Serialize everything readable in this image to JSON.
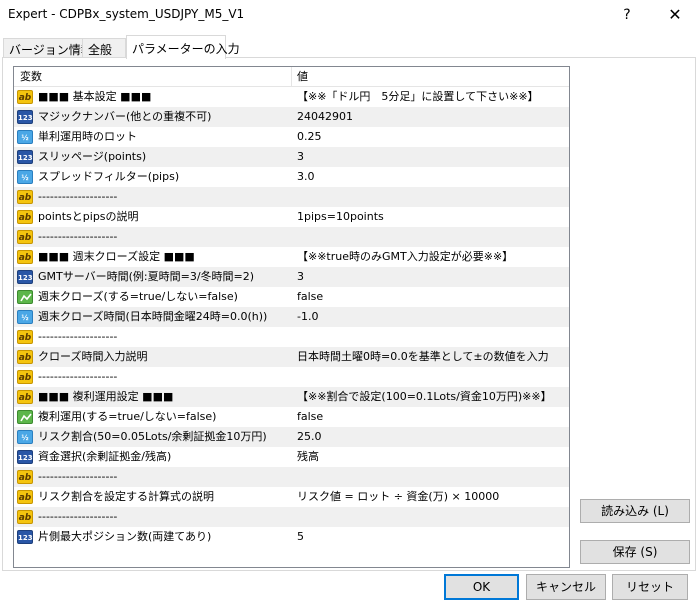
{
  "window": {
    "title": "Expert - CDPBx_system_USDJPY_M5_V1",
    "help_label": "?",
    "close_label": "✕"
  },
  "tabs": [
    {
      "label": "バージョン情報",
      "active": false
    },
    {
      "label": "全般",
      "active": false
    },
    {
      "label": "パラメーターの入力",
      "active": true
    }
  ],
  "grid": {
    "headers": {
      "name": "変数",
      "value": "値"
    },
    "rows": [
      {
        "icon": "ab",
        "name": "■■■ 基本設定 ■■■",
        "value": "【※※「ドル円　5分足」に設置して下さい※※】"
      },
      {
        "icon": "123",
        "name": "マジックナンバー(他との重複不可)",
        "value": "24042901"
      },
      {
        "icon": "frac",
        "name": "単利運用時のロット",
        "value": "0.25"
      },
      {
        "icon": "123",
        "name": "スリッページ(points)",
        "value": "3"
      },
      {
        "icon": "frac",
        "name": "スプレッドフィルター(pips)",
        "value": "3.0"
      },
      {
        "icon": "ab",
        "name": "--------------------",
        "value": ""
      },
      {
        "icon": "ab",
        "name": "pointsとpipsの説明",
        "value": "1pips=10points"
      },
      {
        "icon": "ab",
        "name": "--------------------",
        "value": ""
      },
      {
        "icon": "ab",
        "name": "■■■ 週末クローズ設定 ■■■",
        "value": "【※※true時のみGMT入力設定が必要※※】"
      },
      {
        "icon": "123",
        "name": "GMTサーバー時間(例:夏時間=3/冬時間=2)",
        "value": "3"
      },
      {
        "icon": "bool",
        "name": "週末クローズ(する=true/しない=false)",
        "value": "false"
      },
      {
        "icon": "frac",
        "name": "週末クローズ時間(日本時間金曜24時=0.0(h))",
        "value": "-1.0"
      },
      {
        "icon": "ab",
        "name": "--------------------",
        "value": ""
      },
      {
        "icon": "ab",
        "name": "クローズ時間入力説明",
        "value": "日本時間土曜0時=0.0を基準として±の数値を入力"
      },
      {
        "icon": "ab",
        "name": "--------------------",
        "value": ""
      },
      {
        "icon": "ab",
        "name": "■■■ 複利運用設定 ■■■",
        "value": "【※※割合で設定(100=0.1Lots/資金10万円)※※】"
      },
      {
        "icon": "bool",
        "name": "複利運用(する=true/しない=false)",
        "value": "false"
      },
      {
        "icon": "frac",
        "name": "リスク割合(50=0.05Lots/余剰証拠金10万円)",
        "value": "25.0"
      },
      {
        "icon": "123",
        "name": "資金選択(余剰証拠金/残高)",
        "value": "残高"
      },
      {
        "icon": "ab",
        "name": "--------------------",
        "value": ""
      },
      {
        "icon": "ab",
        "name": "リスク割合を設定する計算式の説明",
        "value": "リスク値 = ロット ÷ 資金(万) × 10000"
      },
      {
        "icon": "ab",
        "name": "--------------------",
        "value": ""
      },
      {
        "icon": "123",
        "name": "片側最大ポジション数(両建てあり)",
        "value": "5"
      }
    ]
  },
  "side_buttons": {
    "load": "読み込み (L)",
    "save": "保存 (S)"
  },
  "bottom_buttons": {
    "ok": "OK",
    "cancel": "キャンセル",
    "reset": "リセット"
  }
}
